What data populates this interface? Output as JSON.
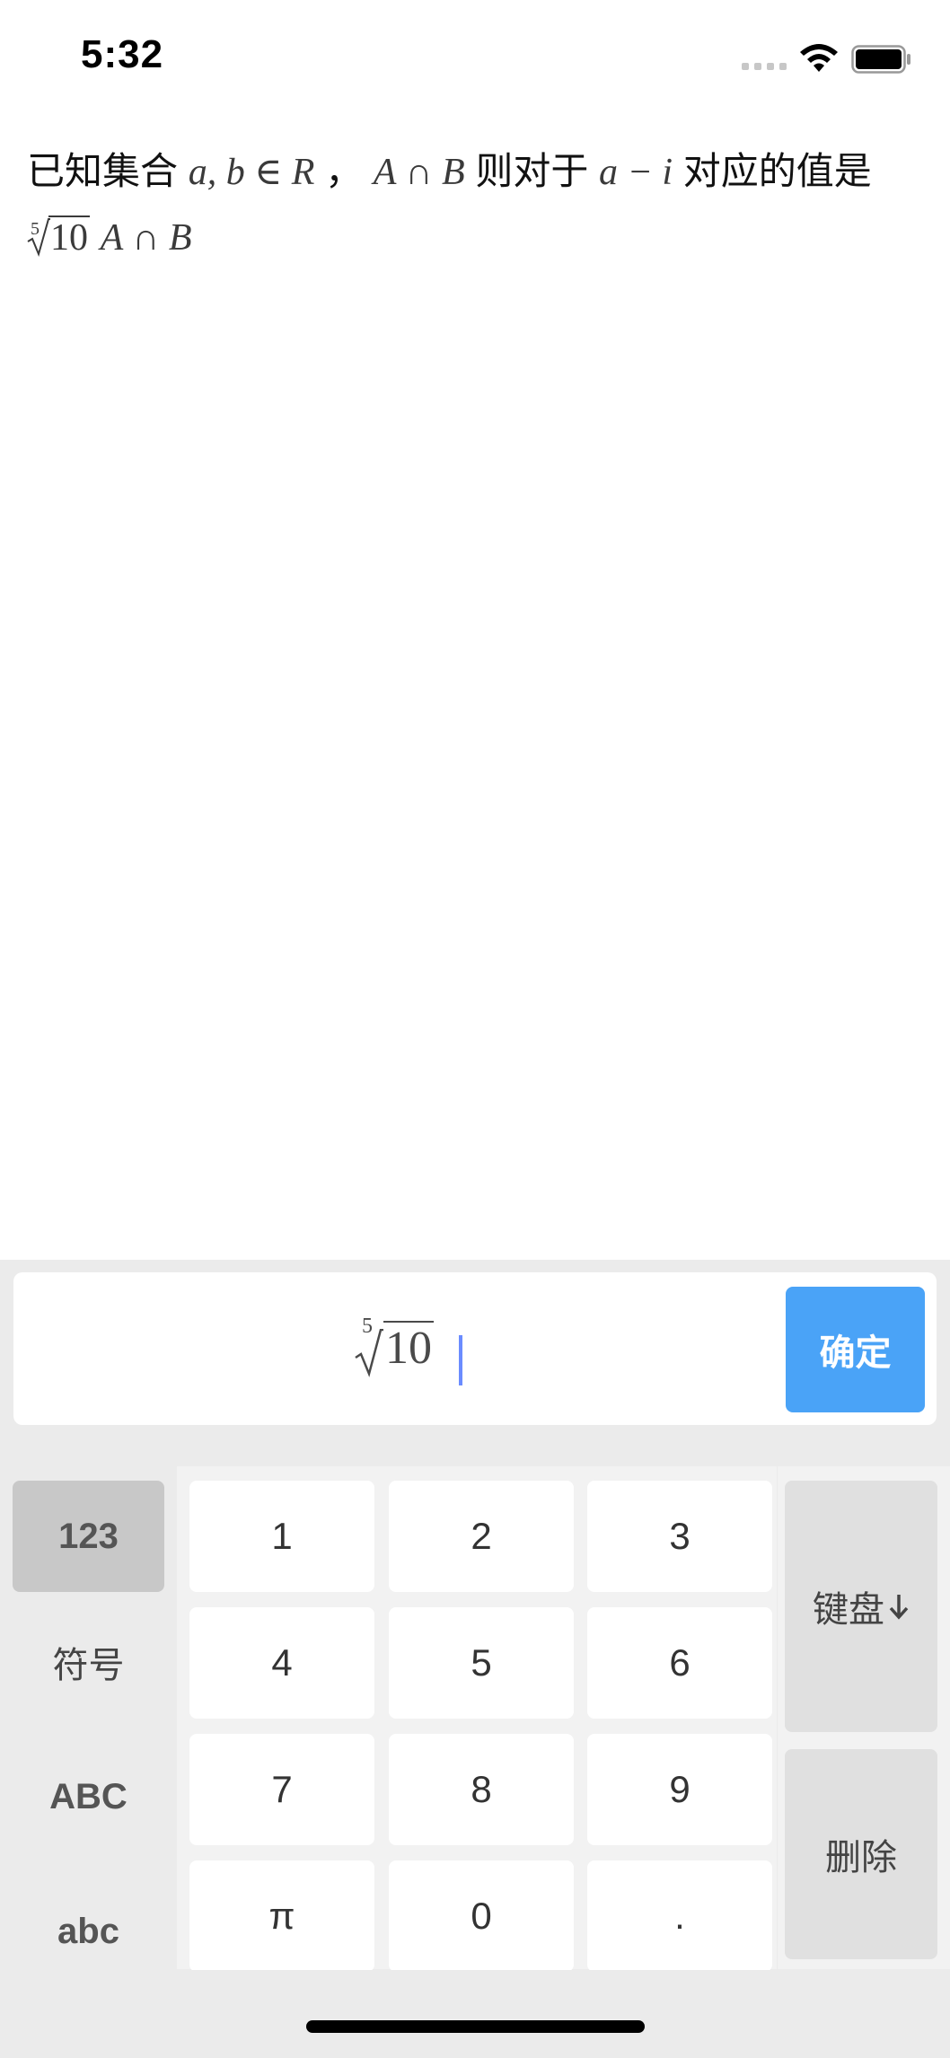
{
  "status_bar": {
    "time": "5:32"
  },
  "question": {
    "p1": "已知集合",
    "m1": "a, b ∈ R",
    "p2": "，",
    "m2": "A ∩ B",
    "p3": "则对于",
    "m3": "a − i",
    "p4": "对应的值是",
    "root_index": "5",
    "root_radicand": "10",
    "m4": "A ∩ B"
  },
  "input": {
    "root_index": "5",
    "root_radicand": "10",
    "confirm_label": "确定"
  },
  "keyboard": {
    "modes": [
      "123",
      "符号",
      "ABC",
      "abc"
    ],
    "active_mode": "123",
    "keys": [
      "1",
      "2",
      "3",
      "4",
      "5",
      "6",
      "7",
      "8",
      "9",
      "π",
      "0",
      "."
    ],
    "hide_keyboard_label": "键盘",
    "delete_label": "删除"
  },
  "colors": {
    "accent": "#4aa3f7",
    "caret": "#6b8cff",
    "panel_bg": "#ebebeb"
  }
}
